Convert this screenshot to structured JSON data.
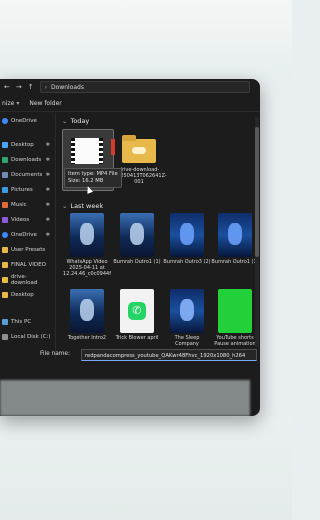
{
  "address": {
    "path": "Downloads"
  },
  "toolbar": {
    "sort_label": "nize",
    "new_folder_label": "New folder"
  },
  "sidebar": {
    "items": [
      {
        "label": "OneDrive"
      },
      {
        "label": "Desktop"
      },
      {
        "label": "Downloads"
      },
      {
        "label": "Documents"
      },
      {
        "label": "Pictures"
      },
      {
        "label": "Music"
      },
      {
        "label": "Videos"
      },
      {
        "label": "OneDrive"
      },
      {
        "label": "User Presets"
      },
      {
        "label": "FINAL VIDEO"
      },
      {
        "label": "drive-download"
      },
      {
        "label": "Desktop"
      },
      {
        "label": "This PC"
      },
      {
        "label": "Local Disk (C:)"
      }
    ]
  },
  "groups": {
    "today": "Today",
    "last_week": "Last week"
  },
  "files": {
    "today": [
      {
        "label": ""
      },
      {
        "label": "drive-download-20250413T062641Z-001"
      }
    ],
    "last_week_row1": [
      {
        "label": "WhatsApp Video 2025-04-11 at 12.24.46_c0c0944f"
      },
      {
        "label": "Bumrah Outro1 (1)"
      },
      {
        "label": "Bumrah Outro3 (2)"
      },
      {
        "label": "Bumrah Outro1 (1)"
      }
    ],
    "last_week_row2": [
      {
        "label": "Together Intro2"
      },
      {
        "label": "Trick Blower april"
      },
      {
        "label": "The Sleep Company"
      },
      {
        "label": "YouTube shorts Pause animation"
      }
    ]
  },
  "tooltip": {
    "type_line": "Item type: MP4 File",
    "size_line": "Size: 16.2 MB"
  },
  "footer": {
    "filename_label": "File name:",
    "filename_value": "redpandacompress_youtube_QAKwr48Fhvc_1920x1080_h264"
  },
  "colors": {
    "window_bg": "#1c1c1c",
    "accent": "#7aa7ff",
    "folder": "#e8b84a",
    "green_thumb": "#22d13a"
  }
}
